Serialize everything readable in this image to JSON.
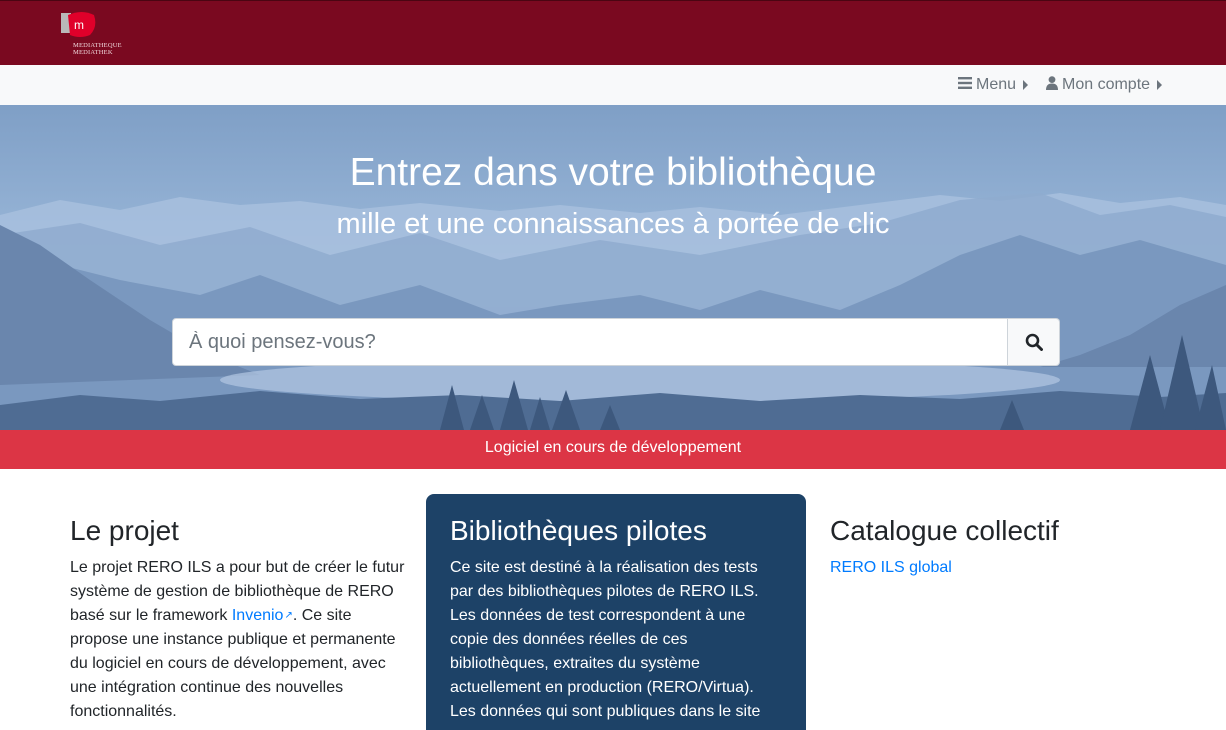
{
  "header": {
    "logo_letter": "m",
    "logo_line1": "MEDIATHEQUE",
    "logo_line2": "MEDIATHEK",
    "brand_color": "#7a0920"
  },
  "nav": {
    "menu_label": "Menu",
    "account_label": "Mon compte"
  },
  "hero": {
    "title": "Entrez dans votre bibliothèque",
    "subtitle": "mille et une connaissances à portée de clic",
    "search_placeholder": "À quoi pensez-vous?"
  },
  "banner": {
    "text": "Logiciel en cours de développement",
    "color": "#dc3545"
  },
  "project": {
    "heading": "Le projet",
    "text_before_link": "Le projet RERO ILS a pour but de créer le futur système de gestion de bibliothèque de RERO basé sur le framework ",
    "link_label": "Invenio",
    "text_after_link": ". Ce site propose une instance publique et permanente du logiciel en cours de développement, avec une intégration continue des nouvelles fonctionnalités."
  },
  "pilots": {
    "heading": "Bibliothèques pilotes",
    "text": "Ce site est destiné à la réalisation des tests par des bibliothèques pilotes de RERO ILS. Les données de test correspondent à une copie des données réelles de ces bibliothèques, extraites du système actuellement en production (RERO/Virtua). Les données qui sont publiques dans le site",
    "bg_color": "#1d4267"
  },
  "catalog": {
    "heading": "Catalogue collectif",
    "link_label": "RERO ILS global"
  }
}
